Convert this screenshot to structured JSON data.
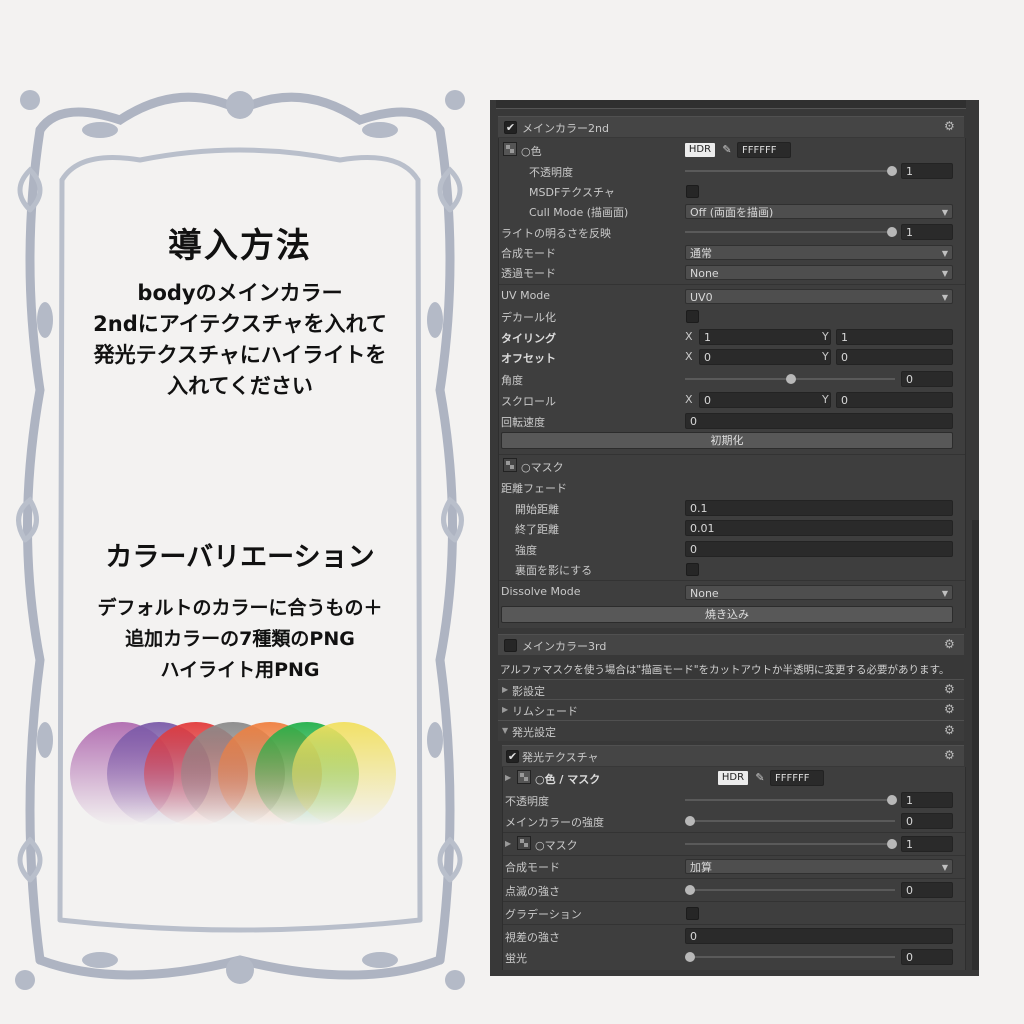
{
  "guide": {
    "title": "導入方法",
    "body_lines": [
      "bodyのメインカラー",
      "2ndにアイテクスチャを入れて",
      "発光テクスチャにハイライトを",
      "入れてください"
    ],
    "variation_title": "カラーバリエーション",
    "variation_lines": [
      "デフォルトのカラーに合うもの＋",
      "追加カラーの7種類のPNG",
      "ハイライト用PNG"
    ],
    "swatch_colors": [
      "#b06bb0",
      "#7a5aa8",
      "#e23a3a",
      "#8a8a8a",
      "#f08040",
      "#22b04a",
      "#f2e060"
    ]
  },
  "inspector": {
    "main2": {
      "header": "メインカラー2nd",
      "color_label": "○色",
      "hdr": "HDR",
      "hex": "FFFFFF",
      "opacity_label": "不透明度",
      "opacity_value": "1",
      "msdf_label": "MSDFテクスチャ",
      "cull_label": "Cull Mode (描画面)",
      "cull_value": "Off (両面を描画)",
      "light_label": "ライトの明るさを反映",
      "light_value": "1",
      "blend_label": "合成モード",
      "blend_value": "通常",
      "transp_label": "透過モード",
      "transp_value": "None",
      "uv_label": "UV Mode",
      "uv_value": "UV0",
      "decal_label": "デカール化",
      "tiling_label": "タイリング",
      "tiling_x": "1",
      "tiling_y": "1",
      "offset_label": "オフセット",
      "offset_x": "0",
      "offset_y": "0",
      "angle_label": "角度",
      "angle_value": "0",
      "scroll_label": "スクロール",
      "scroll_x": "0",
      "scroll_y": "0",
      "rotspeed_label": "回転速度",
      "rotspeed_value": "0",
      "reset_button": "初期化",
      "mask_label": "○マスク",
      "distfade_label": "距離フェード",
      "start_label": "開始距離",
      "start_value": "0.1",
      "end_label": "終了距離",
      "end_value": "0.01",
      "strength_label": "強度",
      "strength_value": "0",
      "backface_label": "裏面を影にする",
      "dissolve_label": "Dissolve Mode",
      "dissolve_value": "None",
      "bake_button": "焼き込み",
      "x": "X",
      "y": "Y"
    },
    "main3": {
      "header": "メインカラー3rd",
      "note": "アルファマスクを使う場合は\"描画モード\"をカットアウトか半透明に変更する必要があります。"
    },
    "shadow_header": "影設定",
    "rim_header": "リムシェード",
    "emission_header": "発光設定",
    "emission": {
      "header": "発光テクスチャ",
      "color_label": "○色 / マスク",
      "hdr": "HDR",
      "hex": "FFFFFF",
      "opacity_label": "不透明度",
      "opacity_value": "1",
      "maincolor_label": "メインカラーの強度",
      "maincolor_value": "0",
      "mask_label": "○マスク",
      "mask_value": "1",
      "blend_label": "合成モード",
      "blend_value": "加算",
      "blink_label": "点滅の強さ",
      "blink_value": "0",
      "gradation_label": "グラデーション",
      "parallax_label": "視差の強さ",
      "parallax_value": "0",
      "fluor_label": "蛍光",
      "fluor_value": "0"
    }
  }
}
